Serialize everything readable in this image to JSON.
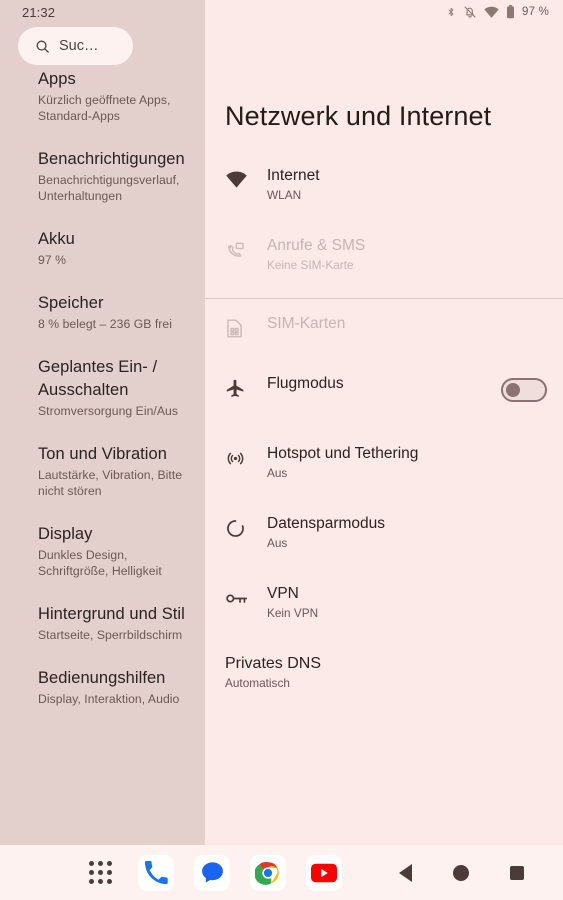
{
  "statusbar": {
    "clock": "21:32",
    "battery_percent": "97 %",
    "icons": [
      "bluetooth-icon",
      "ringer-muted-icon",
      "wifi-icon",
      "battery-icon"
    ]
  },
  "sidebar": {
    "search": {
      "icon": "search-icon",
      "text": "Suc…",
      "placeholder": "Suchen"
    },
    "items": [
      {
        "title": "Apps",
        "subtitle": "Kürzlich geöffnete Apps, Standard-Apps"
      },
      {
        "title": "Benachrichtigungen",
        "subtitle": "Benachrichtigungsverlauf, Unterhaltungen"
      },
      {
        "title": "Akku",
        "subtitle": "97 %"
      },
      {
        "title": "Speicher",
        "subtitle": "8 % belegt – 236 GB frei"
      },
      {
        "title": "Geplantes Ein- / Ausschalten",
        "subtitle": "Stromversorgung Ein/Aus"
      },
      {
        "title": "Ton und Vibration",
        "subtitle": "Lautstärke, Vibration, Bitte nicht stören"
      },
      {
        "title": "Display",
        "subtitle": "Dunkles Design, Schriftgröße, Helligkeit"
      },
      {
        "title": "Hintergrund und Stil",
        "subtitle": "Startseite, Sperrbildschirm"
      },
      {
        "title": "Bedienungshilfen",
        "subtitle": "Display, Interaktion, Audio"
      }
    ]
  },
  "main": {
    "title": "Netzwerk und Internet",
    "rows": [
      {
        "icon": "wifi-icon",
        "title": "Internet",
        "subtitle": "WLAN",
        "disabled": false
      },
      {
        "icon": "calls-sms-icon",
        "title": "Anrufe & SMS",
        "subtitle": "Keine SIM-Karte",
        "disabled": true
      },
      {
        "icon": "sim-card-icon",
        "title": "SIM-Karten",
        "subtitle": "",
        "disabled": true
      },
      {
        "icon": "airplane-icon",
        "title": "Flugmodus",
        "subtitle": "",
        "disabled": false,
        "toggle": "off"
      },
      {
        "icon": "hotspot-icon",
        "title": "Hotspot und Tethering",
        "subtitle": "Aus",
        "disabled": false
      },
      {
        "icon": "data-saver-icon",
        "title": "Datensparmodus",
        "subtitle": "Aus",
        "disabled": false
      },
      {
        "icon": "vpn-key-icon",
        "title": "VPN",
        "subtitle": "Kein VPN",
        "disabled": false
      },
      {
        "icon": "",
        "title": "Privates DNS",
        "subtitle": "Automatisch",
        "disabled": false
      }
    ]
  },
  "taskbar": {
    "apps": [
      "all-apps-icon",
      "phone-icon",
      "messages-icon",
      "chrome-icon",
      "youtube-icon"
    ],
    "nav": [
      "back-button",
      "home-button",
      "recents-button"
    ]
  },
  "colors": {
    "sidebar_bg": "#e3d0cd",
    "main_bg": "#fceae8",
    "taskbar_bg": "#fdf2f0",
    "text_primary": "#2c2220",
    "text_secondary": "#6b5753",
    "text_disabled": "#c6b4b1"
  }
}
